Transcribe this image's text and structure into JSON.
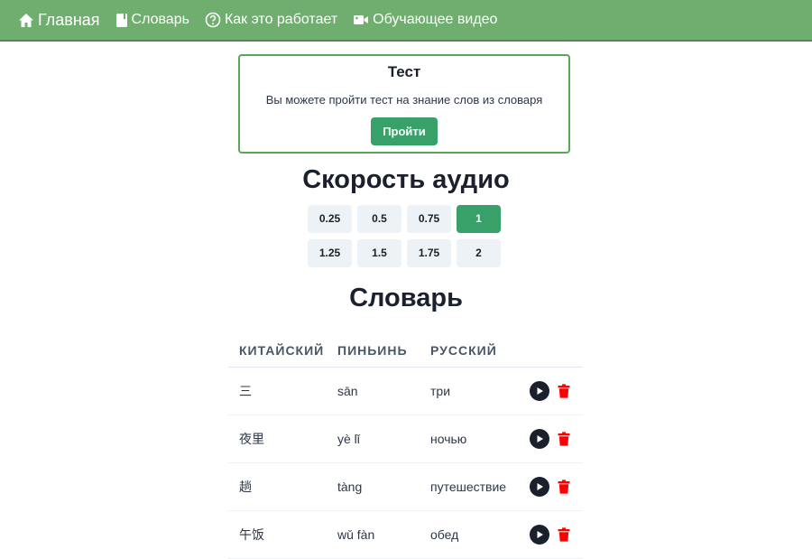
{
  "nav": {
    "items": [
      {
        "label": "Главная",
        "icon": "home-icon"
      },
      {
        "label": "Словарь",
        "icon": "book-icon"
      },
      {
        "label": "Как это работает",
        "icon": "question-circle-icon"
      },
      {
        "label": "Обучающее видео",
        "icon": "video-camera-icon"
      }
    ]
  },
  "test": {
    "title": "Тест",
    "description": "Вы можете пройти тест на знание слов из словаря",
    "button": "Пройти"
  },
  "speed": {
    "title": "Скорость аудио",
    "options": [
      "0.25",
      "0.5",
      "0.75",
      "1",
      "1.25",
      "1.5",
      "1.75",
      "2"
    ],
    "selected": "1"
  },
  "dictionary": {
    "title": "Словарь",
    "headers": {
      "chinese": "КИТАЙСКИЙ",
      "pinyin": "ПИНЬИНЬ",
      "russian": "РУССКИЙ"
    },
    "rows": [
      {
        "chinese": "三",
        "pinyin": "sān",
        "russian": "три"
      },
      {
        "chinese": "夜里",
        "pinyin": "yè lǐ",
        "russian": "ночью"
      },
      {
        "chinese": "趟",
        "pinyin": "tàng",
        "russian": "путешествие"
      },
      {
        "chinese": "午饭",
        "pinyin": "wǔ fàn",
        "russian": "обед"
      }
    ]
  },
  "colors": {
    "navbar": "#6fae6f",
    "accent": "#38a169",
    "delete": "#ff0000"
  }
}
